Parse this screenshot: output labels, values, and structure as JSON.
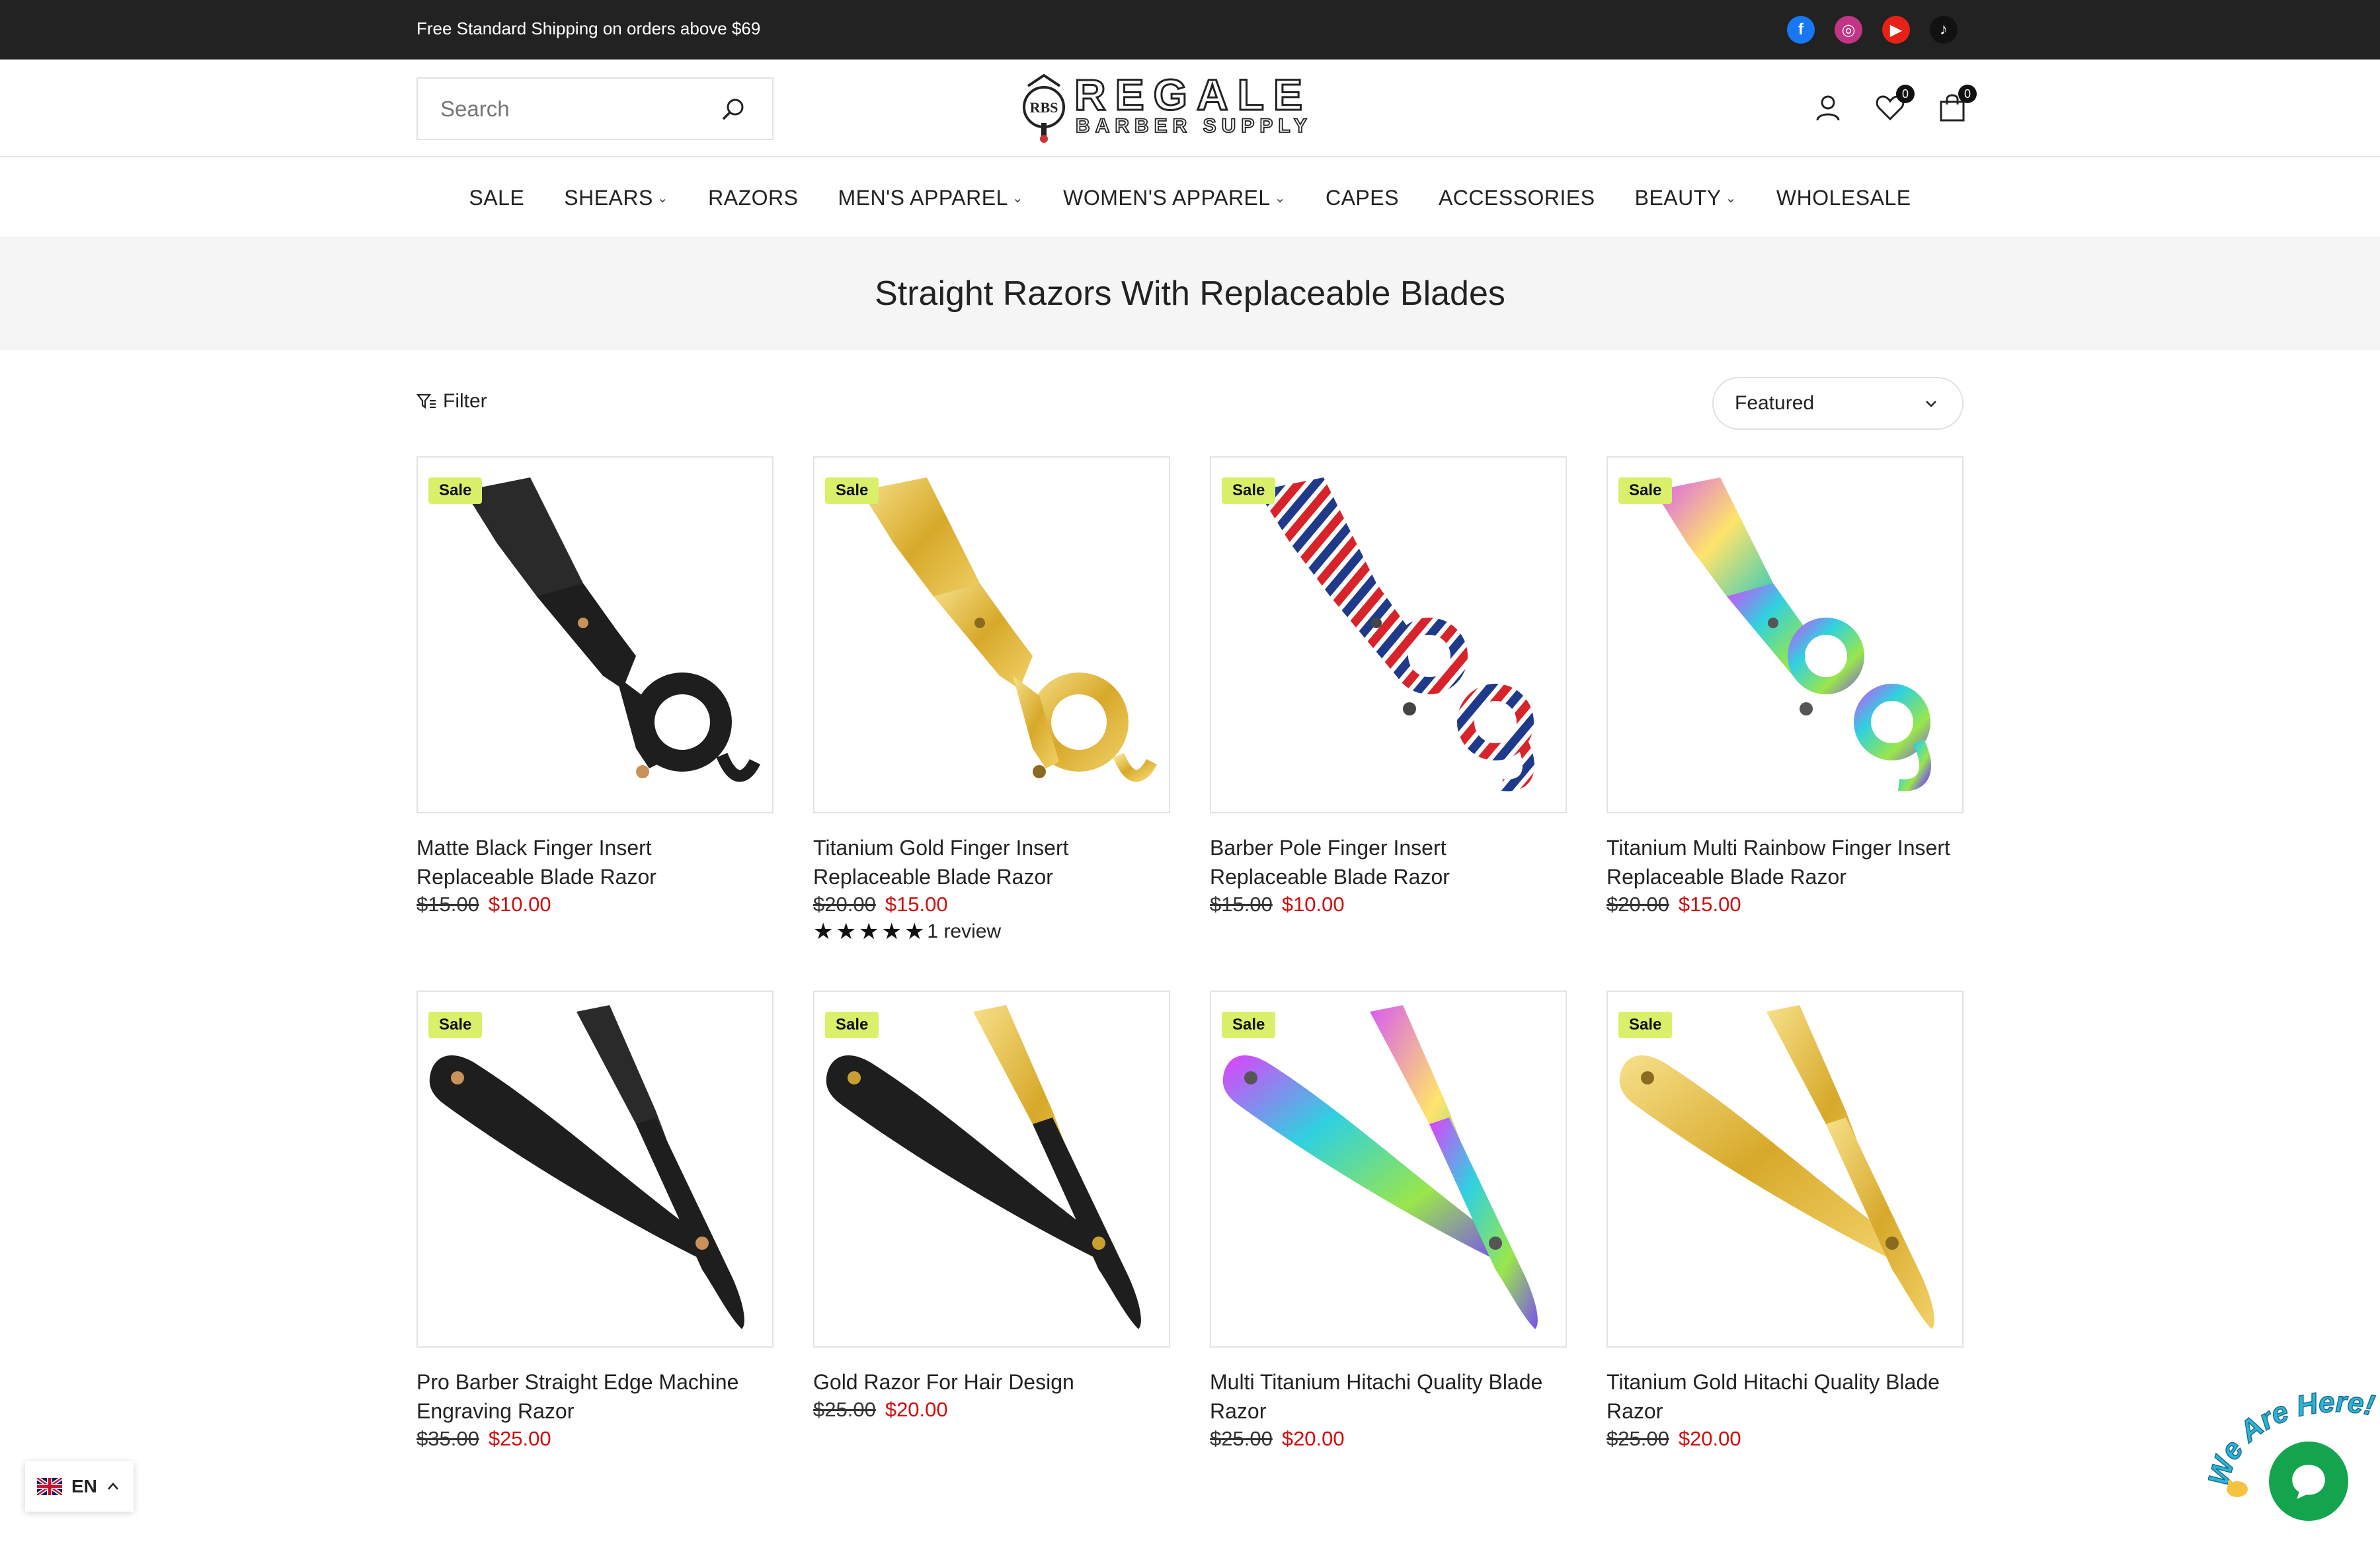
{
  "announcement": {
    "text": "Free Standard Shipping on orders above $69"
  },
  "socials": [
    {
      "name": "facebook-icon",
      "glyph": "f",
      "color": "#1877f2"
    },
    {
      "name": "instagram-icon",
      "glyph": "◎",
      "color": "#c13584"
    },
    {
      "name": "youtube-icon",
      "glyph": "▶",
      "color": "#e62117"
    },
    {
      "name": "tiktok-icon",
      "glyph": "♪",
      "color": "#111111"
    }
  ],
  "header": {
    "search_placeholder": "Search",
    "logo_top": "REGALE",
    "logo_bottom": "BARBER SUPPLY",
    "logo_mark": "RBS",
    "wishlist_count": "0",
    "cart_count": "0"
  },
  "nav": [
    {
      "label": "SALE",
      "dropdown": false
    },
    {
      "label": "SHEARS",
      "dropdown": true
    },
    {
      "label": "RAZORS",
      "dropdown": false
    },
    {
      "label": "MEN'S APPAREL",
      "dropdown": true
    },
    {
      "label": "WOMEN'S APPAREL",
      "dropdown": true
    },
    {
      "label": "CAPES",
      "dropdown": false
    },
    {
      "label": "ACCESSORIES",
      "dropdown": false
    },
    {
      "label": "BEAUTY",
      "dropdown": true
    },
    {
      "label": "WHOLESALE",
      "dropdown": false
    }
  ],
  "page": {
    "title": "Straight Razors With Replaceable Blades"
  },
  "toolbar": {
    "filter_label": "Filter",
    "sort_label": "Featured"
  },
  "products": [
    {
      "badge": "Sale",
      "name": "Matte Black Finger Insert Replaceable Blade Razor",
      "old_price": "$15.00",
      "new_price": "$10.00",
      "style": "black",
      "shape": "finger"
    },
    {
      "badge": "Sale",
      "name": "Titanium Gold Finger Insert Replaceable Blade Razor",
      "old_price": "$20.00",
      "new_price": "$15.00",
      "style": "gold",
      "shape": "finger",
      "rating": {
        "stars": 5,
        "text": "1 review"
      }
    },
    {
      "badge": "Sale",
      "name": "Barber Pole Finger Insert Replaceable Blade Razor",
      "old_price": "$15.00",
      "new_price": "$10.00",
      "style": "pole",
      "shape": "finger2"
    },
    {
      "badge": "Sale",
      "name": "Titanium Multi Rainbow Finger Insert Replaceable Blade Razor",
      "old_price": "$20.00",
      "new_price": "$15.00",
      "style": "rainbow",
      "shape": "finger2"
    },
    {
      "badge": "Sale",
      "name": "Pro Barber Straight Edge Machine Engraving Razor",
      "old_price": "$35.00",
      "new_price": "$25.00",
      "style": "black",
      "shape": "folding"
    },
    {
      "badge": "Sale",
      "name": "Gold Razor For Hair Design",
      "old_price": "$25.00",
      "new_price": "$20.00",
      "style": "blackgold",
      "shape": "folding"
    },
    {
      "badge": "Sale",
      "name": "Multi Titanium Hitachi Quality Blade Razor",
      "old_price": "$25.00",
      "new_price": "$20.00",
      "style": "rainbow",
      "shape": "folding"
    },
    {
      "badge": "Sale",
      "name": "Titanium Gold Hitachi Quality Blade Razor",
      "old_price": "$25.00",
      "new_price": "$20.00",
      "style": "gold",
      "shape": "folding"
    }
  ],
  "language": {
    "code": "EN"
  },
  "chat": {
    "label": "We Are Here!"
  },
  "colors": {
    "sale_badge": "#dbf06a",
    "sale_price": "#d10d0d",
    "chat": "#14a44d"
  }
}
